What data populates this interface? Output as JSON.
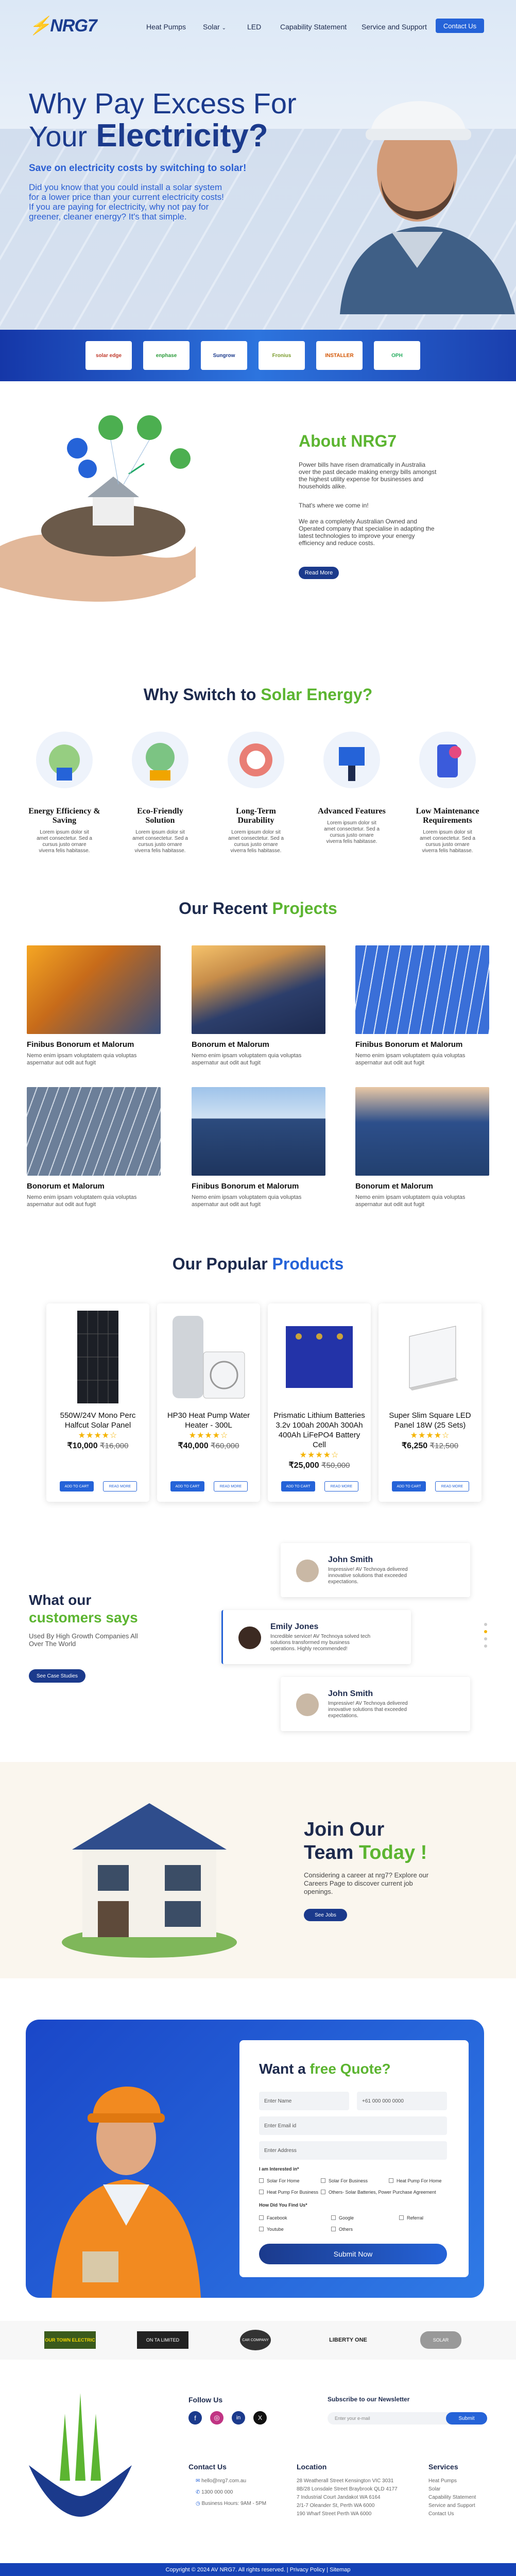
{
  "header": {
    "logo_text": "NRG7",
    "nav": [
      "Heat Pumps",
      "Solar",
      "LED",
      "Capability Statement",
      "Service and Support"
    ],
    "contact_button": "Contact Us"
  },
  "hero": {
    "title_line1": "Why Pay Excess For",
    "title_line2_thin": "Your",
    "title_line2_bold": "Electricity?",
    "subtitle": "Save on electricity costs by switching to solar!",
    "paragraph": "Did you know that you could install a solar system for a lower price than your current  electricity costs! If you are paying for electricity, why not pay for greener, cleaner energy?  It's that simple."
  },
  "partners": [
    "solar edge",
    "enphase",
    "Sungrow",
    "Fronius",
    "INSTALLER",
    "OPH"
  ],
  "about": {
    "title": "About NRG7",
    "p1": "Power bills have risen dramatically in Australia over the past decade making energy bills amongst the highest utility expense for businesses and households alike.",
    "p2": "That's where we come in!",
    "p3": "We are a completely Australian Owned and Operated company that specialise in adapting the latest technologies to improve your energy efficiency and reduce costs.",
    "button": "Read More"
  },
  "features": {
    "title_a": "Why Switch to ",
    "title_b": "Solar Energy?",
    "items": [
      {
        "title": "Energy Efficiency & Saving",
        "text": "Lorem ipsum dolor sit amet consectetur. Sed a cursus justo ornare viverra felis habitasse."
      },
      {
        "title": "Eco-Friendly Solution",
        "text": "Lorem ipsum dolor sit amet consectetur. Sed a cursus justo ornare viverra felis habitasse."
      },
      {
        "title": "Long-Term Durability",
        "text": "Lorem ipsum dolor sit amet consectetur. Sed a cursus justo ornare viverra felis habitasse."
      },
      {
        "title": "Advanced Features",
        "text": "Lorem ipsum dolor sit amet consectetur. Sed a cursus justo ornare viverra felis habitasse."
      },
      {
        "title": "Low Maintenance Requirements",
        "text": "Lorem ipsum dolor sit amet consectetur. Sed a cursus justo ornare viverra felis habitasse."
      }
    ]
  },
  "projects": {
    "title_a": "Our Recent ",
    "title_b": "Projects",
    "items": [
      {
        "title": "Finibus Bonorum et Malorum",
        "text": "Nemo enim ipsam voluptatem quia voluptas aspernatur aut odit aut fugit"
      },
      {
        "title": "Bonorum et Malorum",
        "text": "Nemo enim ipsam voluptatem quia voluptas aspernatur aut odit aut fugit"
      },
      {
        "title": "Finibus Bonorum et Malorum",
        "text": "Nemo enim ipsam voluptatem quia voluptas aspernatur aut odit aut fugit"
      },
      {
        "title": "Bonorum et Malorum",
        "text": "Nemo enim ipsam voluptatem quia voluptas aspernatur aut odit aut fugit"
      },
      {
        "title": "Finibus Bonorum et Malorum",
        "text": "Nemo enim ipsam voluptatem quia voluptas aspernatur aut odit aut fugit"
      },
      {
        "title": "Bonorum et Malorum",
        "text": "Nemo enim ipsam voluptatem quia voluptas aspernatur aut odit aut fugit"
      }
    ]
  },
  "products": {
    "title_a": "Our Popular ",
    "title_b": "Products",
    "items": [
      {
        "name": "550W/24V Mono Perc Halfcut Solar Panel",
        "stars": "★★★★☆",
        "price": "₹10,000",
        "old": "₹16,000",
        "add": "ADD TO CART",
        "more": "READ MORE"
      },
      {
        "name": "HP30 Heat Pump Water Heater - 300L",
        "stars": "★★★★☆",
        "price": "₹40,000",
        "old": "₹60,000",
        "add": "ADD TO CART",
        "more": "READ MORE"
      },
      {
        "name": "Prismatic Lithium Batteries 3.2v 100ah 200Ah 300Ah 400Ah LiFePO4 Battery Cell",
        "stars": "★★★★☆",
        "price": "₹25,000",
        "old": "₹50,000",
        "add": "ADD TO CART",
        "more": "READ MORE"
      },
      {
        "name": "Super Slim Square LED Panel 18W (25 Sets)",
        "stars": "★★★★☆",
        "price": "₹6,250",
        "old": "₹12,500",
        "add": "ADD TO CART",
        "more": "READ MORE"
      }
    ]
  },
  "testimonials": {
    "title_a": "What our",
    "title_b": "customers says",
    "subtitle": "Used By High Growth Companies All Over The World",
    "button": "See Case Studies",
    "items": [
      {
        "name": "John Smith",
        "text": "Impressive! AV Technoya delivered innovative solutions that exceeded expectations."
      },
      {
        "name": "Emily Jones",
        "text": "Incredible service! AV Technoya solved tech solutions transformed my business operations. Highly recommended!"
      },
      {
        "name": "John Smith",
        "text": "Impressive! AV Technoya delivered innovative solutions that exceeded expectations."
      }
    ]
  },
  "careers": {
    "title_a": "Join Our",
    "title_b": "Team ",
    "title_c": "Today !",
    "text": "Considering a career at nrg7? Explore our Careers Page to discover current job openings.",
    "button": "See Jobs"
  },
  "quote": {
    "title_a": "Want a ",
    "title_b": "free Quote?",
    "fields": {
      "name": "Enter Name",
      "phone": "+61 000 000 0000",
      "email": "Enter Email id",
      "address": "Enter Address"
    },
    "interested_label": "I am Interested in*",
    "interests": [
      "Solar For Home",
      "Solar For Business",
      "Heat Pump For Home",
      "Heat Pump For Business",
      "Others- Solar Batteries, Power Purchase Agreement"
    ],
    "found_label": "How Did You Find Us*",
    "sources": [
      "Facebook",
      "Google",
      "Referral",
      "Youtube",
      "Others"
    ],
    "submit": "Submit Now"
  },
  "brands": [
    "OUR TOWN ELECTRIC",
    "ON TA LIMITED",
    "CAR COMPANY",
    "LIBERTY ONE",
    "SOLAR"
  ],
  "footer": {
    "follow": "Follow Us",
    "socials": [
      "f",
      "◎",
      "in",
      "X"
    ],
    "newsletter": "Subscribe to our Newsletter",
    "email_placeholder": "Enter your e-mail",
    "subscribe": "Submit",
    "contact_title": "Contact Us",
    "contact": [
      "hello@nrg7.com.au",
      "1300 000 000",
      "Business Hours: 9AM - 5PM"
    ],
    "location_title": "Location",
    "locations": [
      "28 Weatherall Street Kensington VIC 3031",
      "8B/28 Lonsdale Street Braybrook QLD 4177",
      "7 Industrial Court Jandakot WA 6164",
      "2/1-7 Oleander St, Perth WA 6000",
      "190 Wharf Street Perth WA 6000"
    ],
    "services_title": "Services",
    "services": [
      "Heat Pumps",
      "Solar",
      "Capability Statement",
      "Service and Support",
      "Contact Us"
    ],
    "copyright": "Copyright © 2024 AV NRG7. All rights reserved.  |  Privacy Policy  |  Sitemap"
  },
  "colors": {
    "brand_blue": "#2563d8",
    "navy": "#1b3a8c",
    "green": "#5cb531"
  }
}
